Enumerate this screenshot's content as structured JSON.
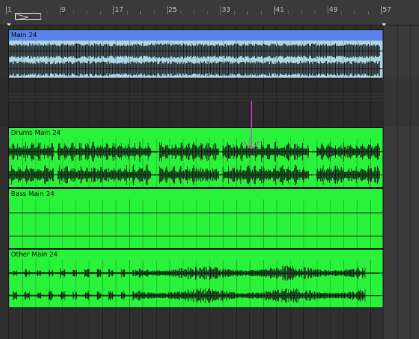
{
  "ruler": {
    "bars": [
      "1",
      "9",
      "17",
      "25",
      "33",
      "41",
      "49",
      "57"
    ]
  },
  "clips": [
    {
      "id": "main",
      "name": "Main 24",
      "title_color": "#5c83e8",
      "body_color": "#add5e6",
      "title_text_color": "#0a0a0a",
      "waveform": "dense"
    },
    {
      "id": "drums",
      "name": "Drums Main 24",
      "title_color": "#29f23a",
      "body_color": "#29f23a",
      "title_text_color": "#0a0a0a",
      "waveform": "drums"
    },
    {
      "id": "bass",
      "name": "Bass Main 24",
      "title_color": "#29f23a",
      "body_color": "#29f23a",
      "title_text_color": "#0a0a0a",
      "waveform": "silent"
    },
    {
      "id": "other",
      "name": "Other Main 24",
      "title_color": "#29f23a",
      "body_color": "#29f23a",
      "title_text_color": "#0a0a0a",
      "waveform": "sparse"
    }
  ],
  "annotation": {
    "icon": "down-arrow-icon",
    "color": "#e048d8"
  }
}
